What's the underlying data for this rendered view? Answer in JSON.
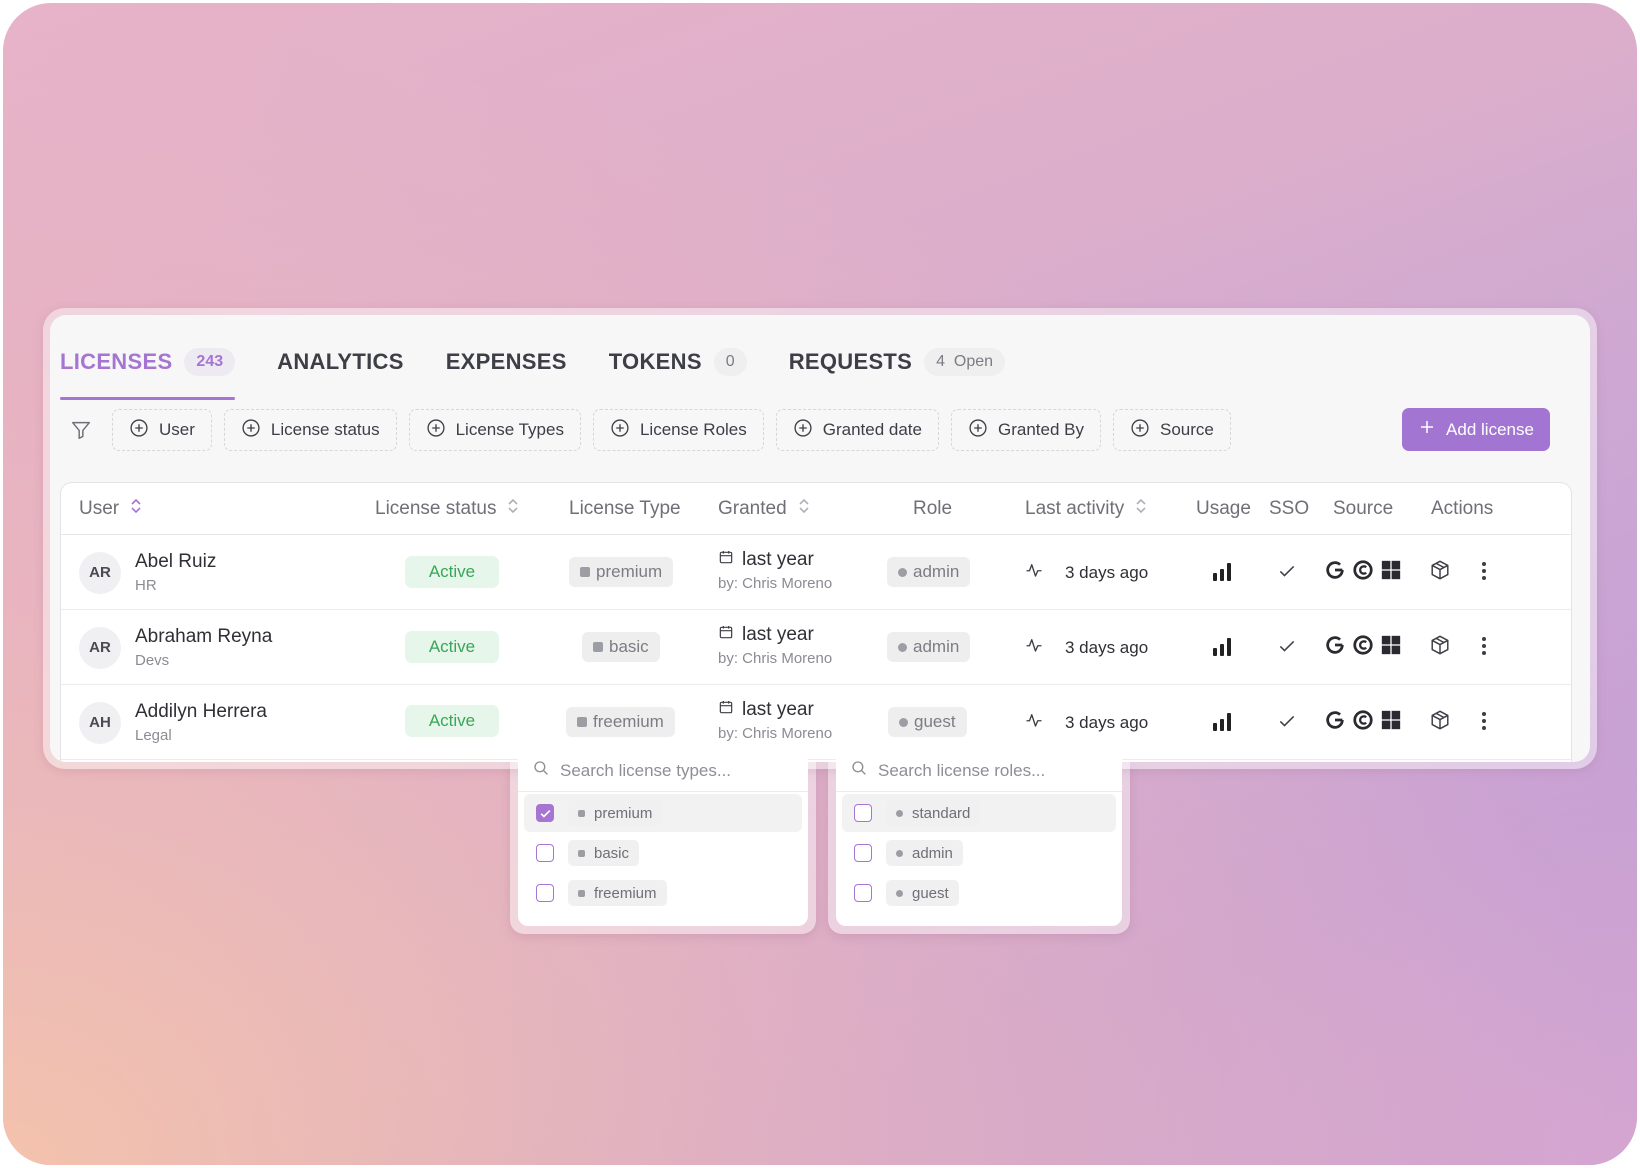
{
  "tabs": [
    {
      "label": "LICENSES",
      "badge": "243",
      "active": true
    },
    {
      "label": "ANALYTICS",
      "badge": null
    },
    {
      "label": "EXPENSES",
      "badge": null
    },
    {
      "label": "TOKENS",
      "badge": "0"
    },
    {
      "label": "REQUESTS",
      "badge": "4  Open"
    }
  ],
  "filters": [
    "User",
    "License status",
    "License Types",
    "License Roles",
    "Granted date",
    "Granted By",
    "Source"
  ],
  "add_button": "Add license",
  "columns": {
    "user": "User",
    "license_status": "License status",
    "license_type": "License Type",
    "granted": "Granted",
    "role": "Role",
    "last_activity": "Last activity",
    "usage": "Usage",
    "sso": "SSO",
    "source": "Source",
    "actions": "Actions"
  },
  "rows": [
    {
      "initials": "AR",
      "name": "Abel Ruiz",
      "dept": "HR",
      "status": "Active",
      "type": "premium",
      "granted": "last year",
      "granted_by": "by: Chris Moreno",
      "role": "admin",
      "activity": "3 days ago"
    },
    {
      "initials": "AR",
      "name": "Abraham Reyna",
      "dept": "Devs",
      "status": "Active",
      "type": "basic",
      "granted": "last year",
      "granted_by": "by: Chris Moreno",
      "role": "admin",
      "activity": "3 days ago"
    },
    {
      "initials": "AH",
      "name": "Addilyn Herrera",
      "dept": "Legal",
      "status": "Active",
      "type": "freemium",
      "granted": "last year",
      "granted_by": "by: Chris Moreno",
      "role": "guest",
      "activity": "3 days ago"
    }
  ],
  "type_dropdown": {
    "placeholder": "Search license types...",
    "options": [
      {
        "label": "premium",
        "checked": true
      },
      {
        "label": "basic",
        "checked": false
      },
      {
        "label": "freemium",
        "checked": false
      }
    ]
  },
  "role_dropdown": {
    "placeholder": "Search license roles...",
    "options": [
      {
        "label": "standard",
        "checked": false
      },
      {
        "label": "admin",
        "checked": false
      },
      {
        "label": "guest",
        "checked": false
      }
    ]
  },
  "colors": {
    "accent": "#a675d2",
    "active_bg": "#e6f6ea",
    "active_text": "#3aa657"
  },
  "icons": {
    "filter": "filter-icon",
    "chip": "plus-circle-icon",
    "sort": "sort-icon",
    "calendar": "calendar-icon",
    "activity": "activity-pulse-icon",
    "usage": "signal-bars-icon",
    "sso": "check-icon",
    "sources": [
      "google-icon",
      "c-logo-icon",
      "windows-icon"
    ],
    "action": "package-icon",
    "more": "more-vertical-icon",
    "search": "search-icon"
  }
}
